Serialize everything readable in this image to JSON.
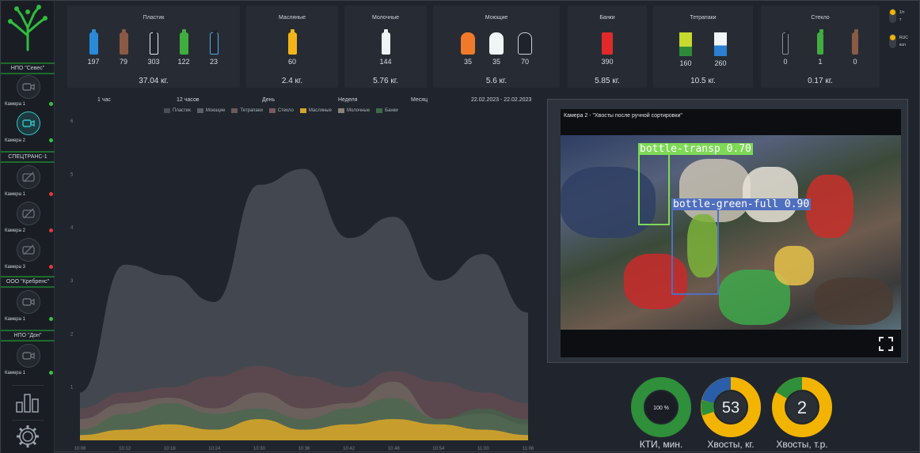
{
  "sidebar": {
    "groups": [
      {
        "label": "НПО \"Севес\""
      },
      {
        "label": "СПЕЦТРАНС-1"
      },
      {
        "label": "ООО \"Кребренс\""
      },
      {
        "label": "НПО \"Дон\""
      }
    ],
    "cameras": [
      {
        "label": "Камера 1",
        "status": "#37c23c"
      },
      {
        "label": "Камера 2",
        "status": "#37c23c"
      },
      {
        "label": "Камера 1",
        "status": "#e03b3b"
      },
      {
        "label": "Камера 2",
        "status": "#e03b3b"
      },
      {
        "label": "Камера 3",
        "status": "#e03b3b"
      },
      {
        "label": "Камера 1",
        "status": "#37c23c"
      },
      {
        "label": "Камера 1",
        "status": "#37c23c"
      }
    ]
  },
  "categories": [
    {
      "title": "Пластик",
      "weight": "37.04 кг.",
      "counts": [
        "197",
        "79",
        "303",
        "122",
        "23"
      ]
    },
    {
      "title": "Масляные",
      "weight": "2.4 кг.",
      "counts": [
        "60"
      ]
    },
    {
      "title": "Молочные",
      "weight": "5.76 кг.",
      "counts": [
        "144"
      ]
    },
    {
      "title": "Моющие",
      "weight": "5.6 кг.",
      "counts": [
        "35",
        "35",
        "70"
      ]
    },
    {
      "title": "Банки",
      "weight": "5.85 кг.",
      "counts": [
        "390"
      ]
    },
    {
      "title": "Тетрапаки",
      "weight": "10.5 кг.",
      "counts": [
        "160",
        "260"
      ]
    },
    {
      "title": "Стекло",
      "weight": "0.17 кг.",
      "counts": [
        "0",
        "1",
        "0"
      ]
    }
  ],
  "toggles": {
    "a1": "1/т",
    "a2": "т",
    "b1": "RUC",
    "b2": "кол"
  },
  "colors": {
    "accent": "#2ec4c6",
    "yellow": "#f3b400",
    "green": "#2f8f3a",
    "blue": "#2a5ea8"
  },
  "time_ranges": [
    "1 час",
    "12 часов",
    "День",
    "Неделя",
    "Месяц",
    "22.02.2023 - 22.02.2023"
  ],
  "legend": [
    {
      "name": "Пластик",
      "color": "#4a4f57"
    },
    {
      "name": "Моющие",
      "color": "#5b6068"
    },
    {
      "name": "Тетрапаки",
      "color": "#6b5a5a"
    },
    {
      "name": "Стекло",
      "color": "#7a5a5e"
    },
    {
      "name": "Масляные",
      "color": "#d4a42a"
    },
    {
      "name": "Молочные",
      "color": "#8a8378"
    },
    {
      "name": "Банки",
      "color": "#3f6a4a"
    }
  ],
  "chart_data": {
    "type": "area",
    "x": [
      "10:06",
      "10:12",
      "10:18",
      "10:24",
      "10:30",
      "10:36",
      "10:42",
      "10:48",
      "10:54",
      "11:00",
      "11:06"
    ],
    "yticks": [
      "1",
      "2",
      "3",
      "4",
      "5",
      "6"
    ],
    "ylim": [
      0,
      6
    ],
    "series": [
      {
        "name": "Пластик",
        "values": [
          0.9,
          3.3,
          3.1,
          2.6,
          4.8,
          5.1,
          3.8,
          4.2,
          3.0,
          3.5,
          2.4
        ]
      },
      {
        "name": "Тетрапаки",
        "values": [
          0.6,
          0.9,
          1.0,
          1.2,
          1.4,
          1.2,
          1.0,
          1.3,
          1.1,
          0.9,
          0.7
        ]
      },
      {
        "name": "Моющие",
        "values": [
          0.4,
          0.7,
          0.8,
          0.6,
          0.9,
          0.6,
          0.7,
          1.1,
          0.4,
          0.5,
          0.3
        ]
      },
      {
        "name": "Банки",
        "values": [
          0.2,
          0.5,
          0.7,
          0.5,
          0.6,
          0.4,
          0.6,
          0.8,
          0.4,
          0.6,
          0.4
        ]
      },
      {
        "name": "Масляные",
        "values": [
          0.1,
          0.2,
          0.3,
          0.2,
          0.4,
          0.2,
          0.3,
          0.4,
          0.3,
          0.2,
          0.1
        ]
      }
    ]
  },
  "camera": {
    "title": "Камера 2 - \"Хвосты после ручной сортировки\"",
    "detections": [
      {
        "label": "bottle-transp 0.70",
        "color": "#7ed957"
      },
      {
        "label": "bottle-green-full 0.90",
        "color": "#4f6fbf"
      }
    ]
  },
  "donuts": [
    {
      "value": "100 %",
      "label": "КТИ, мин."
    },
    {
      "value": "53",
      "label": "Хвосты, кг."
    },
    {
      "value": "2",
      "label": "Хвосты, т.р."
    }
  ]
}
